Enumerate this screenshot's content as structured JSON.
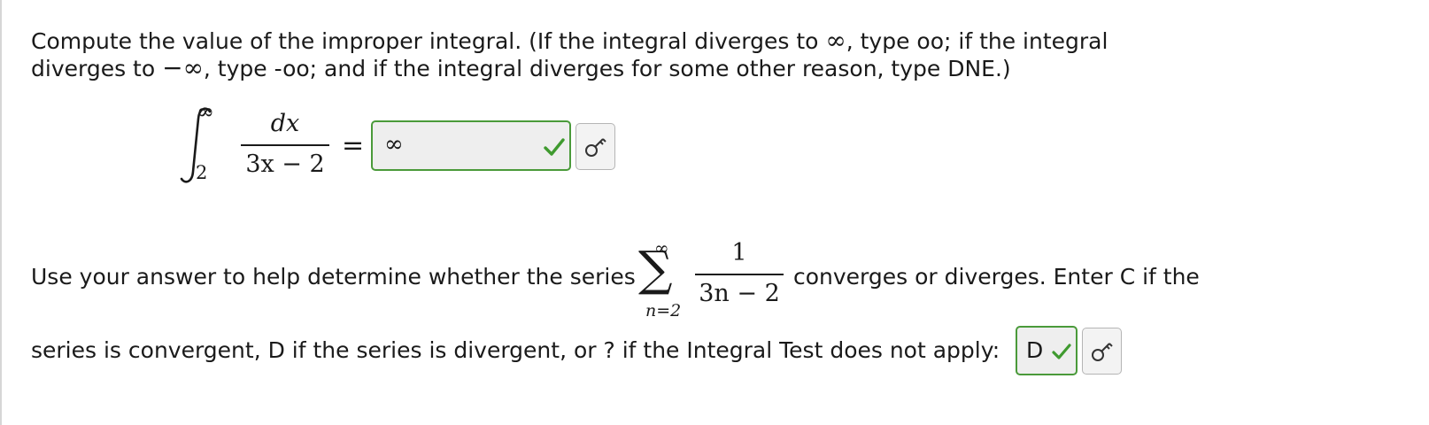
{
  "question": {
    "line1_text": "Compute the value of the improper integral. (If the integral diverges to",
    "line1_infinity": "∞",
    "line1_rest": ", type oo; if the integral",
    "line2_start": "diverges to",
    "line2_neg_infinity": "−∞",
    "line2_rest": ", type -oo; and if the integral diverges for some other reason, type DNE.)"
  },
  "integral": {
    "upper_limit": "∞",
    "lower_limit": "2",
    "numerator": "dx",
    "denominator": "3x − 2",
    "equals": "="
  },
  "answer1": {
    "value": "∞",
    "status": "correct"
  },
  "series_prompt": {
    "before": "Use your answer to help determine whether the series",
    "after": "converges or diverges. Enter C if the",
    "line2": "series is convergent, D if the series is divergent, or ? if the Integral Test does not apply:"
  },
  "series": {
    "sigma": "∑",
    "upper": "∞",
    "lower": "n=2",
    "numerator": "1",
    "denominator": "3n − 2"
  },
  "answer2": {
    "value": "D",
    "status": "correct"
  },
  "colors": {
    "correct_border": "#4a9a3a",
    "check": "#3f9a2f",
    "text": "#1a1a1a"
  }
}
